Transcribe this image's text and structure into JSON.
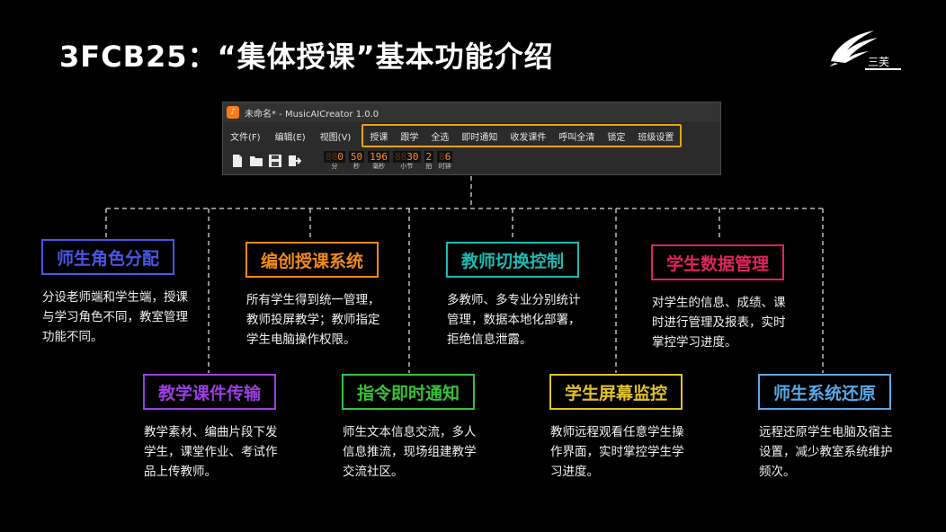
{
  "title": "3FCB25：“集体授课”基本功能介绍",
  "logo": {
    "text": "三芙"
  },
  "app": {
    "window_title": "未命名* - MusicAICreator 1.0.0",
    "menu": [
      "文件(F)",
      "编辑(E)",
      "视图(V)"
    ],
    "class_menu": [
      "授课",
      "跟学",
      "全选",
      "即时通知",
      "收发课件",
      "呼叫全清",
      "锁定",
      "班级设置"
    ],
    "toolbar_icons": [
      "new-file-icon",
      "open-folder-icon",
      "save-icon",
      "export-icon"
    ],
    "counter": [
      {
        "dim": "88",
        "value": "0",
        "label": "分"
      },
      {
        "dim": "",
        "value": "50",
        "label": "秒"
      },
      {
        "dim": "",
        "value": "196",
        "label": "毫秒"
      },
      {
        "dim": "88",
        "value": "30",
        "label": "小节"
      },
      {
        "dim": "",
        "value": "2",
        "label": "拍"
      },
      {
        "dim": "8",
        "value": "6",
        "label": "时钟"
      }
    ]
  },
  "features": [
    {
      "title": "师生角色分配",
      "color": "#4b55e6",
      "desc": "分设老师端和学生端，授课与学习角色不同，教室管理功能不同。"
    },
    {
      "title": "教学课件传输",
      "color": "#9b3fe0",
      "desc": "教学素材、编曲片段下发学生，课堂作业、考试作品上传教师。"
    },
    {
      "title": "编创授课系统",
      "color": "#f08a1a",
      "desc": "所有学生得到统一管理，教师投屏教学；教师指定学生电脑操作权限。"
    },
    {
      "title": "指令即时通知",
      "color": "#39c23a",
      "desc": "师生文本信息交流，多人信息推流，现场组建教学交流社区。"
    },
    {
      "title": "教师切换控制",
      "color": "#1fb9b0",
      "desc": "多教师、多专业分别统计管理，数据本地化部署，拒绝信息泄露。"
    },
    {
      "title": "学生屏幕监控",
      "color": "#e2c22a",
      "desc": "教师远程观看任意学生操作界面，实时掌控学生学习进度。"
    },
    {
      "title": "学生数据管理",
      "color": "#e0245e",
      "desc": "对学生的信息、成绩、课时进行管理及报表，实时掌控学习进度。"
    },
    {
      "title": "师生系统还原",
      "color": "#5aa8e6",
      "desc": "远程还原学生电脑及宿主设置，减少教室系统维护频次。"
    }
  ]
}
